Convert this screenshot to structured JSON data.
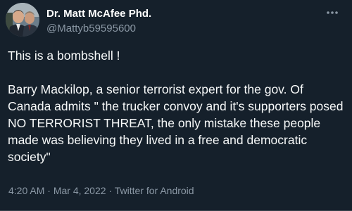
{
  "tweet": {
    "author": {
      "display_name": "Dr. Matt McAfee Phd.",
      "handle": "@Mattyb59595600"
    },
    "text": "This is a bombshell !\n\nBarry Mackilop, a senior terrorist expert for the gov. Of Canada admits \" the trucker convoy and it's supporters posed NO TERRORIST THREAT, the only mistake these people made was believing they lived in a free and democratic society\"",
    "time": "4:20 AM",
    "separator": "·",
    "date": "Mar 4, 2022",
    "source": "Twitter for Android"
  },
  "icons": {
    "more": "more-horizontal-icon",
    "avatar": "avatar-photo"
  },
  "colors": {
    "background": "#15202b",
    "primary_text": "#f7f9f9",
    "secondary_text": "#8b98a5"
  }
}
